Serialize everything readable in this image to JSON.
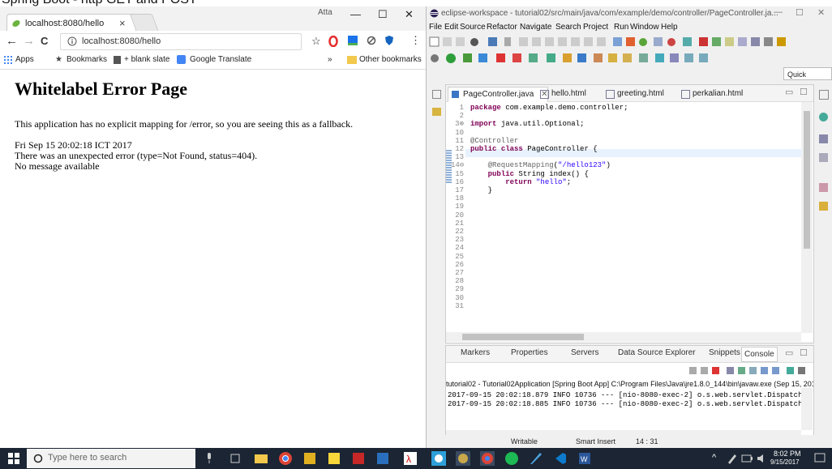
{
  "caption": "Spring Boot - http GET and POST",
  "chrome": {
    "tab_title": "localhost:8080/hello",
    "tab_close": "×",
    "window_user": "Atta",
    "minimize": "—",
    "maximize": "☐",
    "close": "✕",
    "back": "←",
    "forward": "→",
    "reload": "C",
    "url": "localhost:8080/hello",
    "star": "☆",
    "menu": "⋮",
    "bookmarks": {
      "apps": "Apps",
      "bookmarks": "Bookmarks",
      "blank_slate": "+ blank slate",
      "google_translate": "Google Translate",
      "overflow": "»",
      "other": "Other bookmarks"
    }
  },
  "page": {
    "title": "Whitelabel Error Page",
    "line1": "This application has no explicit mapping for /error, so you are seeing this as a fallback.",
    "line2": "Fri Sep 15 20:02:18 ICT 2017",
    "line3": "There was an unexpected error (type=Not Found, status=404).",
    "line4": "No message available"
  },
  "eclipse": {
    "title": "eclipse-workspace - tutorial02/src/main/java/com/example/demo/controller/PageController.ja...",
    "menu": [
      "File",
      "Edit",
      "Source",
      "Refactor",
      "Navigate",
      "Search",
      "Project",
      "Run",
      "Window",
      "Help"
    ],
    "quick_access": "Quick Access",
    "editor_tabs": [
      "PageController.java",
      "hello.html",
      "greeting.html",
      "perkalian.html"
    ],
    "code": [
      {
        "n": "1",
        "t": "package com.example.demo.controller;"
      },
      {
        "n": "2",
        "t": ""
      },
      {
        "n": "3⊕",
        "t": "import java.util.Optional;"
      },
      {
        "n": "10",
        "t": ""
      },
      {
        "n": "11",
        "t": "@Controller"
      },
      {
        "n": "12",
        "t": "public class PageController {"
      },
      {
        "n": "13",
        "t": ""
      },
      {
        "n": "14⊖",
        "t": "    @RequestMapping(\"/hello123\")"
      },
      {
        "n": "15",
        "t": "    public String index() {"
      },
      {
        "n": "16",
        "t": "        return \"hello\";"
      },
      {
        "n": "17",
        "t": "    }"
      },
      {
        "n": "18",
        "t": ""
      },
      {
        "n": "19",
        "t": ""
      },
      {
        "n": "20",
        "t": ""
      },
      {
        "n": "21",
        "t": ""
      },
      {
        "n": "22",
        "t": ""
      },
      {
        "n": "23",
        "t": ""
      },
      {
        "n": "24",
        "t": ""
      },
      {
        "n": "25",
        "t": ""
      },
      {
        "n": "26",
        "t": ""
      },
      {
        "n": "27",
        "t": ""
      },
      {
        "n": "28",
        "t": ""
      },
      {
        "n": "29",
        "t": ""
      },
      {
        "n": "30",
        "t": ""
      },
      {
        "n": "31",
        "t": ""
      }
    ],
    "bottom_tabs": [
      "Markers",
      "Properties",
      "Servers",
      "Data Source Explorer",
      "Snippets",
      "Console"
    ],
    "console_header": "tutorial02 - Tutorial02Application [Spring Boot App] C:\\Program Files\\Java\\jre1.8.0_144\\bin\\javaw.exe (Sep 15, 201",
    "console_lines": [
      "2017-09-15 20:02:18.879  INFO 10736 --- [nio-8080-exec-2] o.s.web.servlet.Dispatche",
      "2017-09-15 20:02:18.885  INFO 10736 --- [nio-8080-exec-2] o.s.web.servlet.Dispatche"
    ],
    "status": {
      "writable": "Writable",
      "insert": "Smart Insert",
      "position": "14 : 31"
    }
  },
  "taskbar": {
    "search_placeholder": "Type here to search",
    "time": "8:02 PM",
    "date": "9/15/2017"
  }
}
